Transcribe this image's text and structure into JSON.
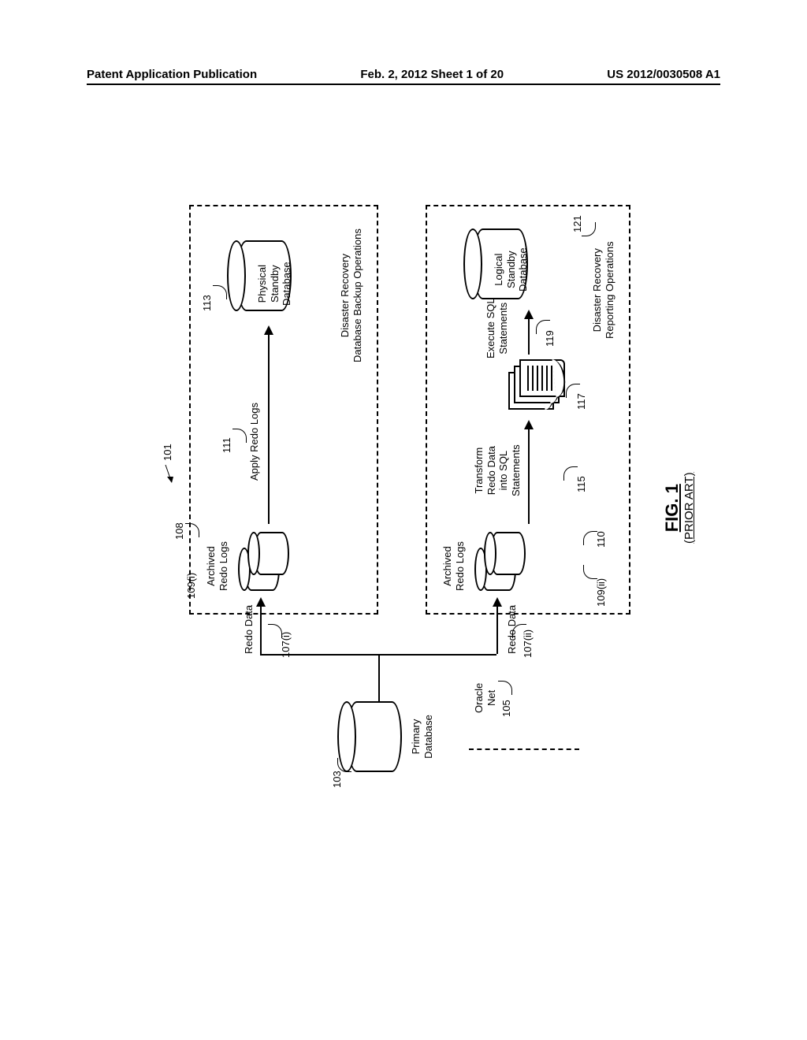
{
  "header": {
    "left": "Patent Application Publication",
    "center": "Feb. 2, 2012   Sheet 1 of 20",
    "right": "US 2012/0030508 A1"
  },
  "figure": {
    "caption": "FIG. 1",
    "subcaption": "(PRIOR ART)"
  },
  "labels": {
    "primary_db": "Primary\nDatabase",
    "oracle_net": "Oracle\nNet",
    "redo_data_top": "Redo Data",
    "redo_data_bottom": "Redo Data",
    "archived_top": "Archived\nRedo Logs",
    "archived_bottom": "Archived\nRedo Logs",
    "apply_redo": "Apply Redo Logs",
    "physical_standby": "Physical\nStandby\nDatabase",
    "dr_backup": "Disaster Recovery\nDatabase Backup Operations",
    "transform": "Transform\nRedo Data\ninto SQL\nStatements",
    "execute_sql": "Execute SQL\nStatements",
    "logical_standby": "Logical\nStandby\nDatabase",
    "dr_reporting": "Disaster Recovery\nReporting Operations"
  },
  "refs": {
    "r101": "101",
    "r103": "103",
    "r105": "105",
    "r107i": "107(i)",
    "r107ii": "107(ii)",
    "r108": "108",
    "r109i": "109(i)",
    "r109ii": "109(ii)",
    "r110": "110",
    "r111": "111",
    "r113": "113",
    "r115": "115",
    "r117": "117",
    "r119": "119",
    "r121": "121"
  }
}
